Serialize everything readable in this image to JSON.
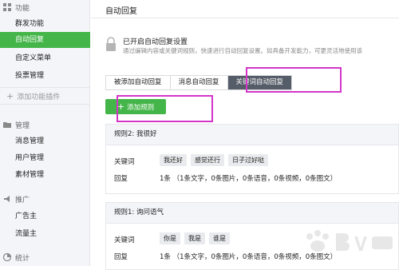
{
  "sidebar": {
    "function_header": "功能",
    "function_items": [
      {
        "label": "群发功能"
      },
      {
        "label": "自动回复",
        "active": true
      },
      {
        "label": "自定义菜单"
      },
      {
        "label": "投票管理"
      }
    ],
    "add_plugin_label": "添加功能插件",
    "manage_header": "管理",
    "manage_items": [
      {
        "label": "消息管理"
      },
      {
        "label": "用户管理"
      },
      {
        "label": "素材管理"
      }
    ],
    "promo_header": "推广",
    "promo_items": [
      {
        "label": "广告主"
      },
      {
        "label": "流量主"
      }
    ],
    "stats_header": "统计"
  },
  "main": {
    "title": "自动回复",
    "status_title": "已开启自动回复设置",
    "status_desc": "通过编辑内容或关键词规则，快速进行自动回复设置。如具备开发能力，可更灵活地使用该",
    "tabs": [
      {
        "label": "被添加自动回复"
      },
      {
        "label": "消息自动回复"
      },
      {
        "label": "关键词自动回复",
        "active": true
      }
    ],
    "add_rule_label": "添加规则",
    "rules": [
      {
        "title": "规则2: 我很好",
        "keyword_label": "关键词",
        "keywords": [
          "我还好",
          "感觉还行",
          "日子过好哒"
        ],
        "reply_label": "回复",
        "reply_summary": "1条 （1条文字，0条图片，0条语音，0条视频，0条图文）"
      },
      {
        "title": "规则1: 询问语气",
        "keyword_label": "关键词",
        "keywords": [
          "你是",
          "我是",
          "谁是"
        ],
        "reply_label": "回复",
        "reply_summary": "1条 （1条文字，0条图片，0条语音，0条视频，0条图文）"
      }
    ]
  },
  "colors": {
    "accent_green": "#44b549",
    "active_tab": "#555d68",
    "highlight": "#d236c8",
    "sidebar_bg": "#f4f5f9"
  },
  "icons": {
    "function": "grid-icon",
    "manage": "folder-icon",
    "promo": "megaphone-icon",
    "stats": "chart-icon",
    "status": "lock-icon",
    "add": "plus-icon"
  }
}
